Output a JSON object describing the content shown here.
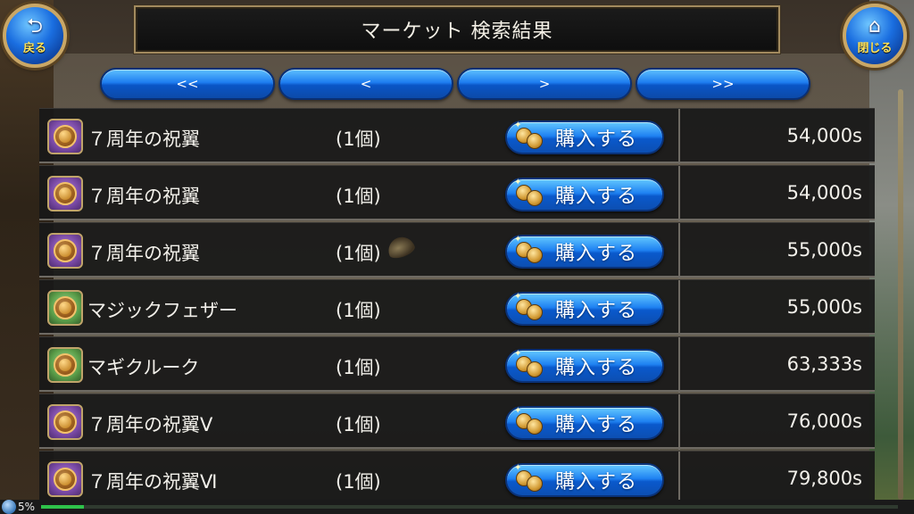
{
  "header": {
    "title": "マーケット 検索結果",
    "back_label": "戻る",
    "close_label": "閉じる"
  },
  "pager": {
    "first": "<<",
    "prev": "<",
    "next": ">",
    "last": ">>"
  },
  "buy_label": "購入する",
  "items": [
    {
      "name": "７周年の祝翼",
      "qty": "(1個)",
      "price": "54,000s",
      "icon": "purple-coin-icon"
    },
    {
      "name": "７周年の祝翼",
      "qty": "(1個)",
      "price": "54,000s",
      "icon": "purple-coin-icon"
    },
    {
      "name": "７周年の祝翼",
      "qty": "(1個)",
      "price": "55,000s",
      "icon": "purple-coin-icon"
    },
    {
      "name": "マジックフェザー",
      "qty": "(1個)",
      "price": "55,000s",
      "icon": "green-coin-icon"
    },
    {
      "name": "マギクルーク",
      "qty": "(1個)",
      "price": "63,333s",
      "icon": "green-coin-icon"
    },
    {
      "name": "７周年の祝翼Ⅴ",
      "qty": "(1個)",
      "price": "76,000s",
      "icon": "purple-coin-icon"
    },
    {
      "name": "７周年の祝翼Ⅵ",
      "qty": "(1個)",
      "price": "79,800s",
      "icon": "purple-coin-icon"
    }
  ],
  "status": {
    "percent": "5%",
    "progress": 0.05
  },
  "colors": {
    "button_blue": "#1e7df0",
    "frame_gold": "#c9a766",
    "row_bg": "#181818"
  }
}
